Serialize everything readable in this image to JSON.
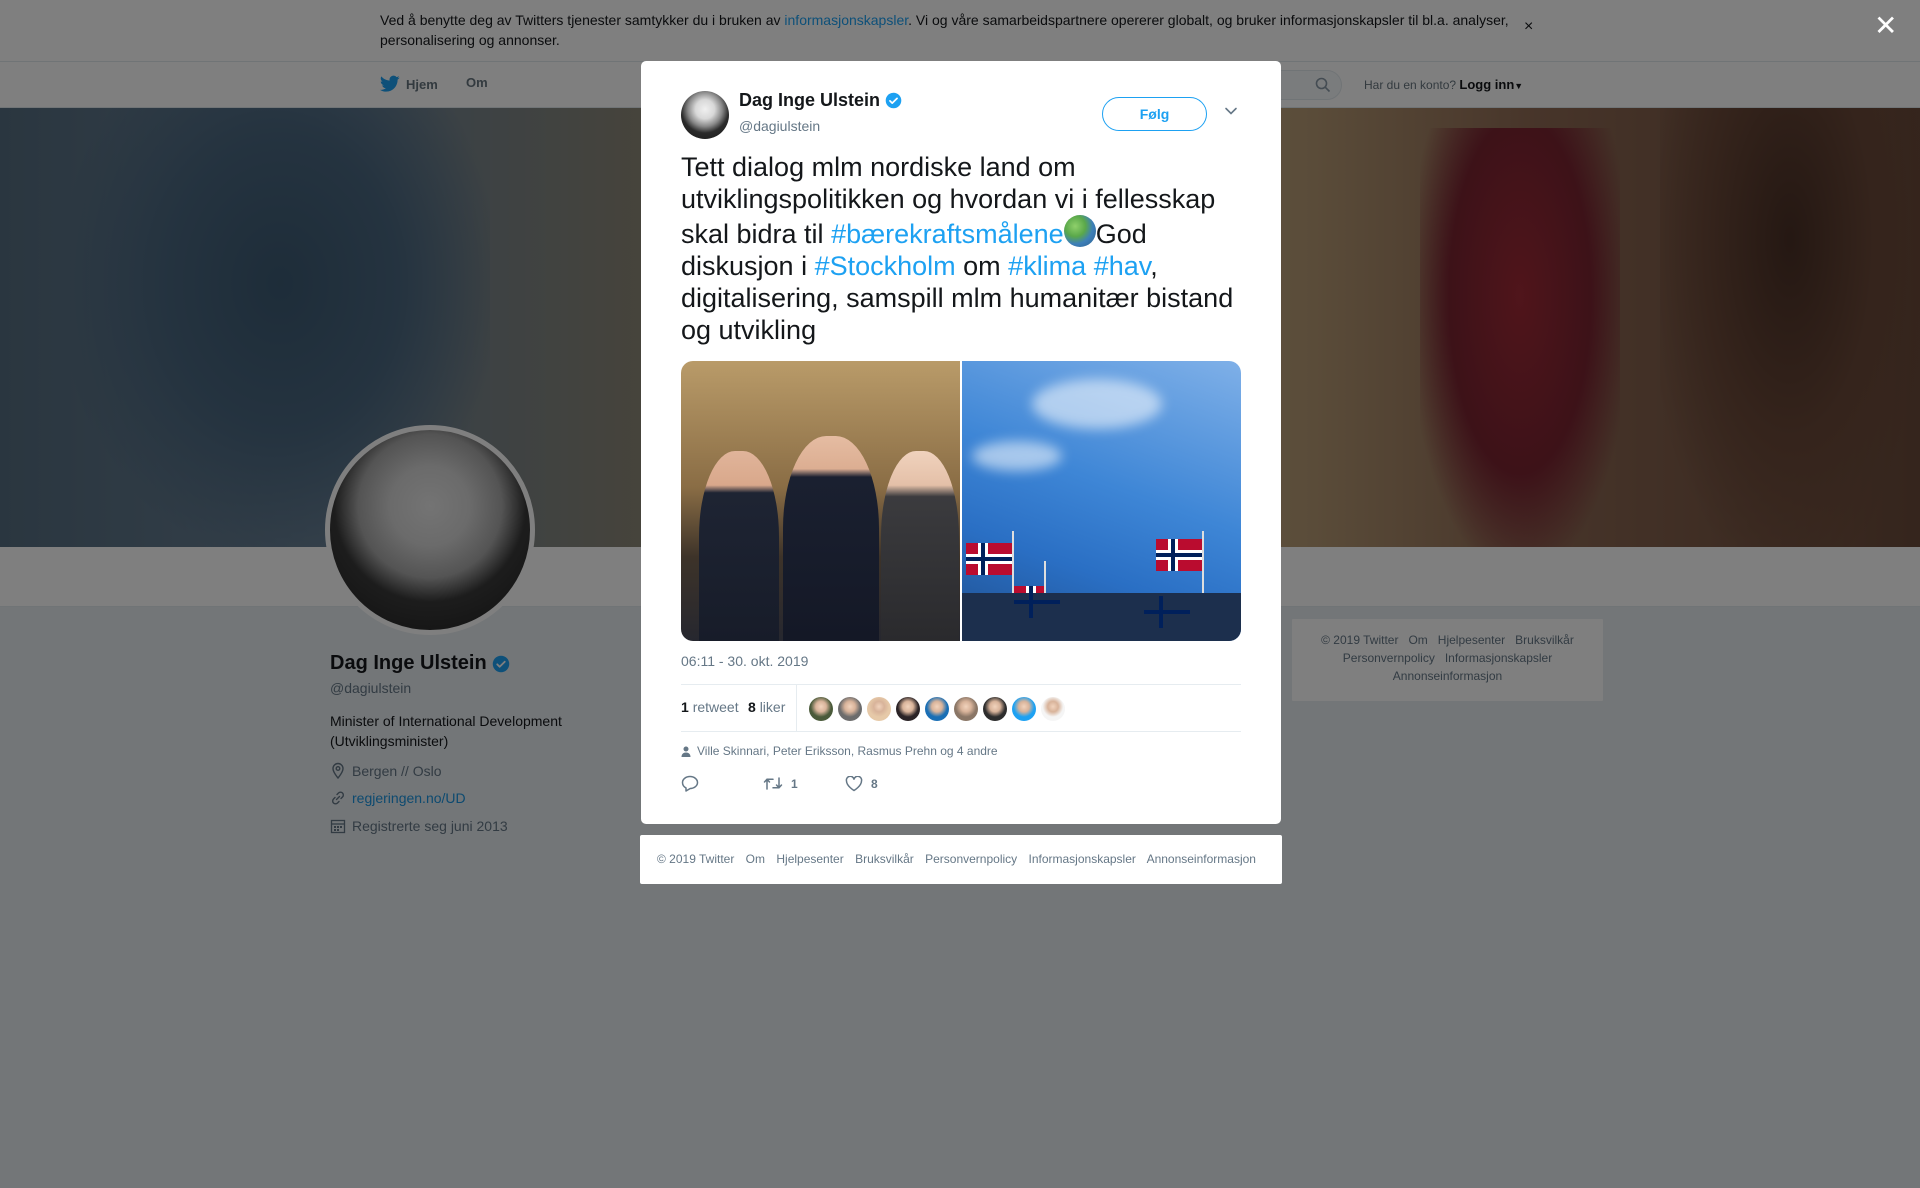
{
  "cookie_banner": {
    "text_before": "Ved å benytte deg av Twitters tjenester samtykker du i bruken av ",
    "link": "informasjonskapsler",
    "text_after": ". Vi og våre samarbeidspartnere opererer globalt, og bruker informasjonskapsler til bl.a. analyser, personalisering og annonser.",
    "close": "×"
  },
  "nav": {
    "home": "Hjem",
    "about": "Om",
    "account_prompt": "Har du en konto?",
    "login": "Logg inn"
  },
  "profile": {
    "name": "Dag Inge Ulstein",
    "handle": "@dagiulstein",
    "bio": "Minister of International Development (Utviklingsminister)",
    "location": "Bergen // Oslo",
    "website": "regjeringen.no/UD",
    "joined": "Registrerte seg juni 2013"
  },
  "side_footer": {
    "row1": [
      "© 2019 Twitter",
      "Om",
      "Hjelpesenter",
      "Bruksvilkår"
    ],
    "row2": [
      "Personvernpolicy",
      "Informasjonskapsler"
    ],
    "row3": [
      "Annonseinformasjon"
    ]
  },
  "overlay_close": "✕",
  "tweet": {
    "author_name": "Dag Inge Ulstein",
    "author_handle": "@dagiulstein",
    "follow_label": "Følg",
    "text_part1": "Tett dialog mlm nordiske land om utviklingspolitikken og hvordan vi i fellesskap skal bidra til ",
    "hashtag1": "#bærekraftsmålene",
    "text_part2": "God diskusjon i ",
    "hashtag2": "#Stockholm",
    "text_part3": " om ",
    "hashtag3": "#klima",
    "text_space": " ",
    "hashtag4": "#hav",
    "text_part4": ", digitalisering, samspill mlm humanitær bistand og utvikling",
    "timestamp": "06:11 - 30. okt. 2019",
    "retweet_count": "1",
    "retweet_label": "retweet",
    "like_count": "8",
    "like_label": "liker",
    "liked_by": "Ville Skinnari, Peter Eriksson, Rasmus Prehn og 4 andre",
    "action_retweets": "1",
    "action_likes": "8",
    "liker_colors": [
      "#4a5a3a",
      "#6c6c6c",
      "#e6c9a8",
      "#2a2326",
      "#1a6fb5",
      "#8a7666",
      "#2d2d2d",
      "#1da1f2",
      "#f5f5f5"
    ]
  },
  "modal_footer": [
    "© 2019 Twitter",
    "Om",
    "Hjelpesenter",
    "Bruksvilkår",
    "Personvernpolicy",
    "Informasjonskapsler",
    "Annonseinformasjon"
  ],
  "colors": {
    "accent": "#1da1f2",
    "verified": "#1da1f2",
    "overlay": "rgba(0,0,0,0.5)"
  }
}
